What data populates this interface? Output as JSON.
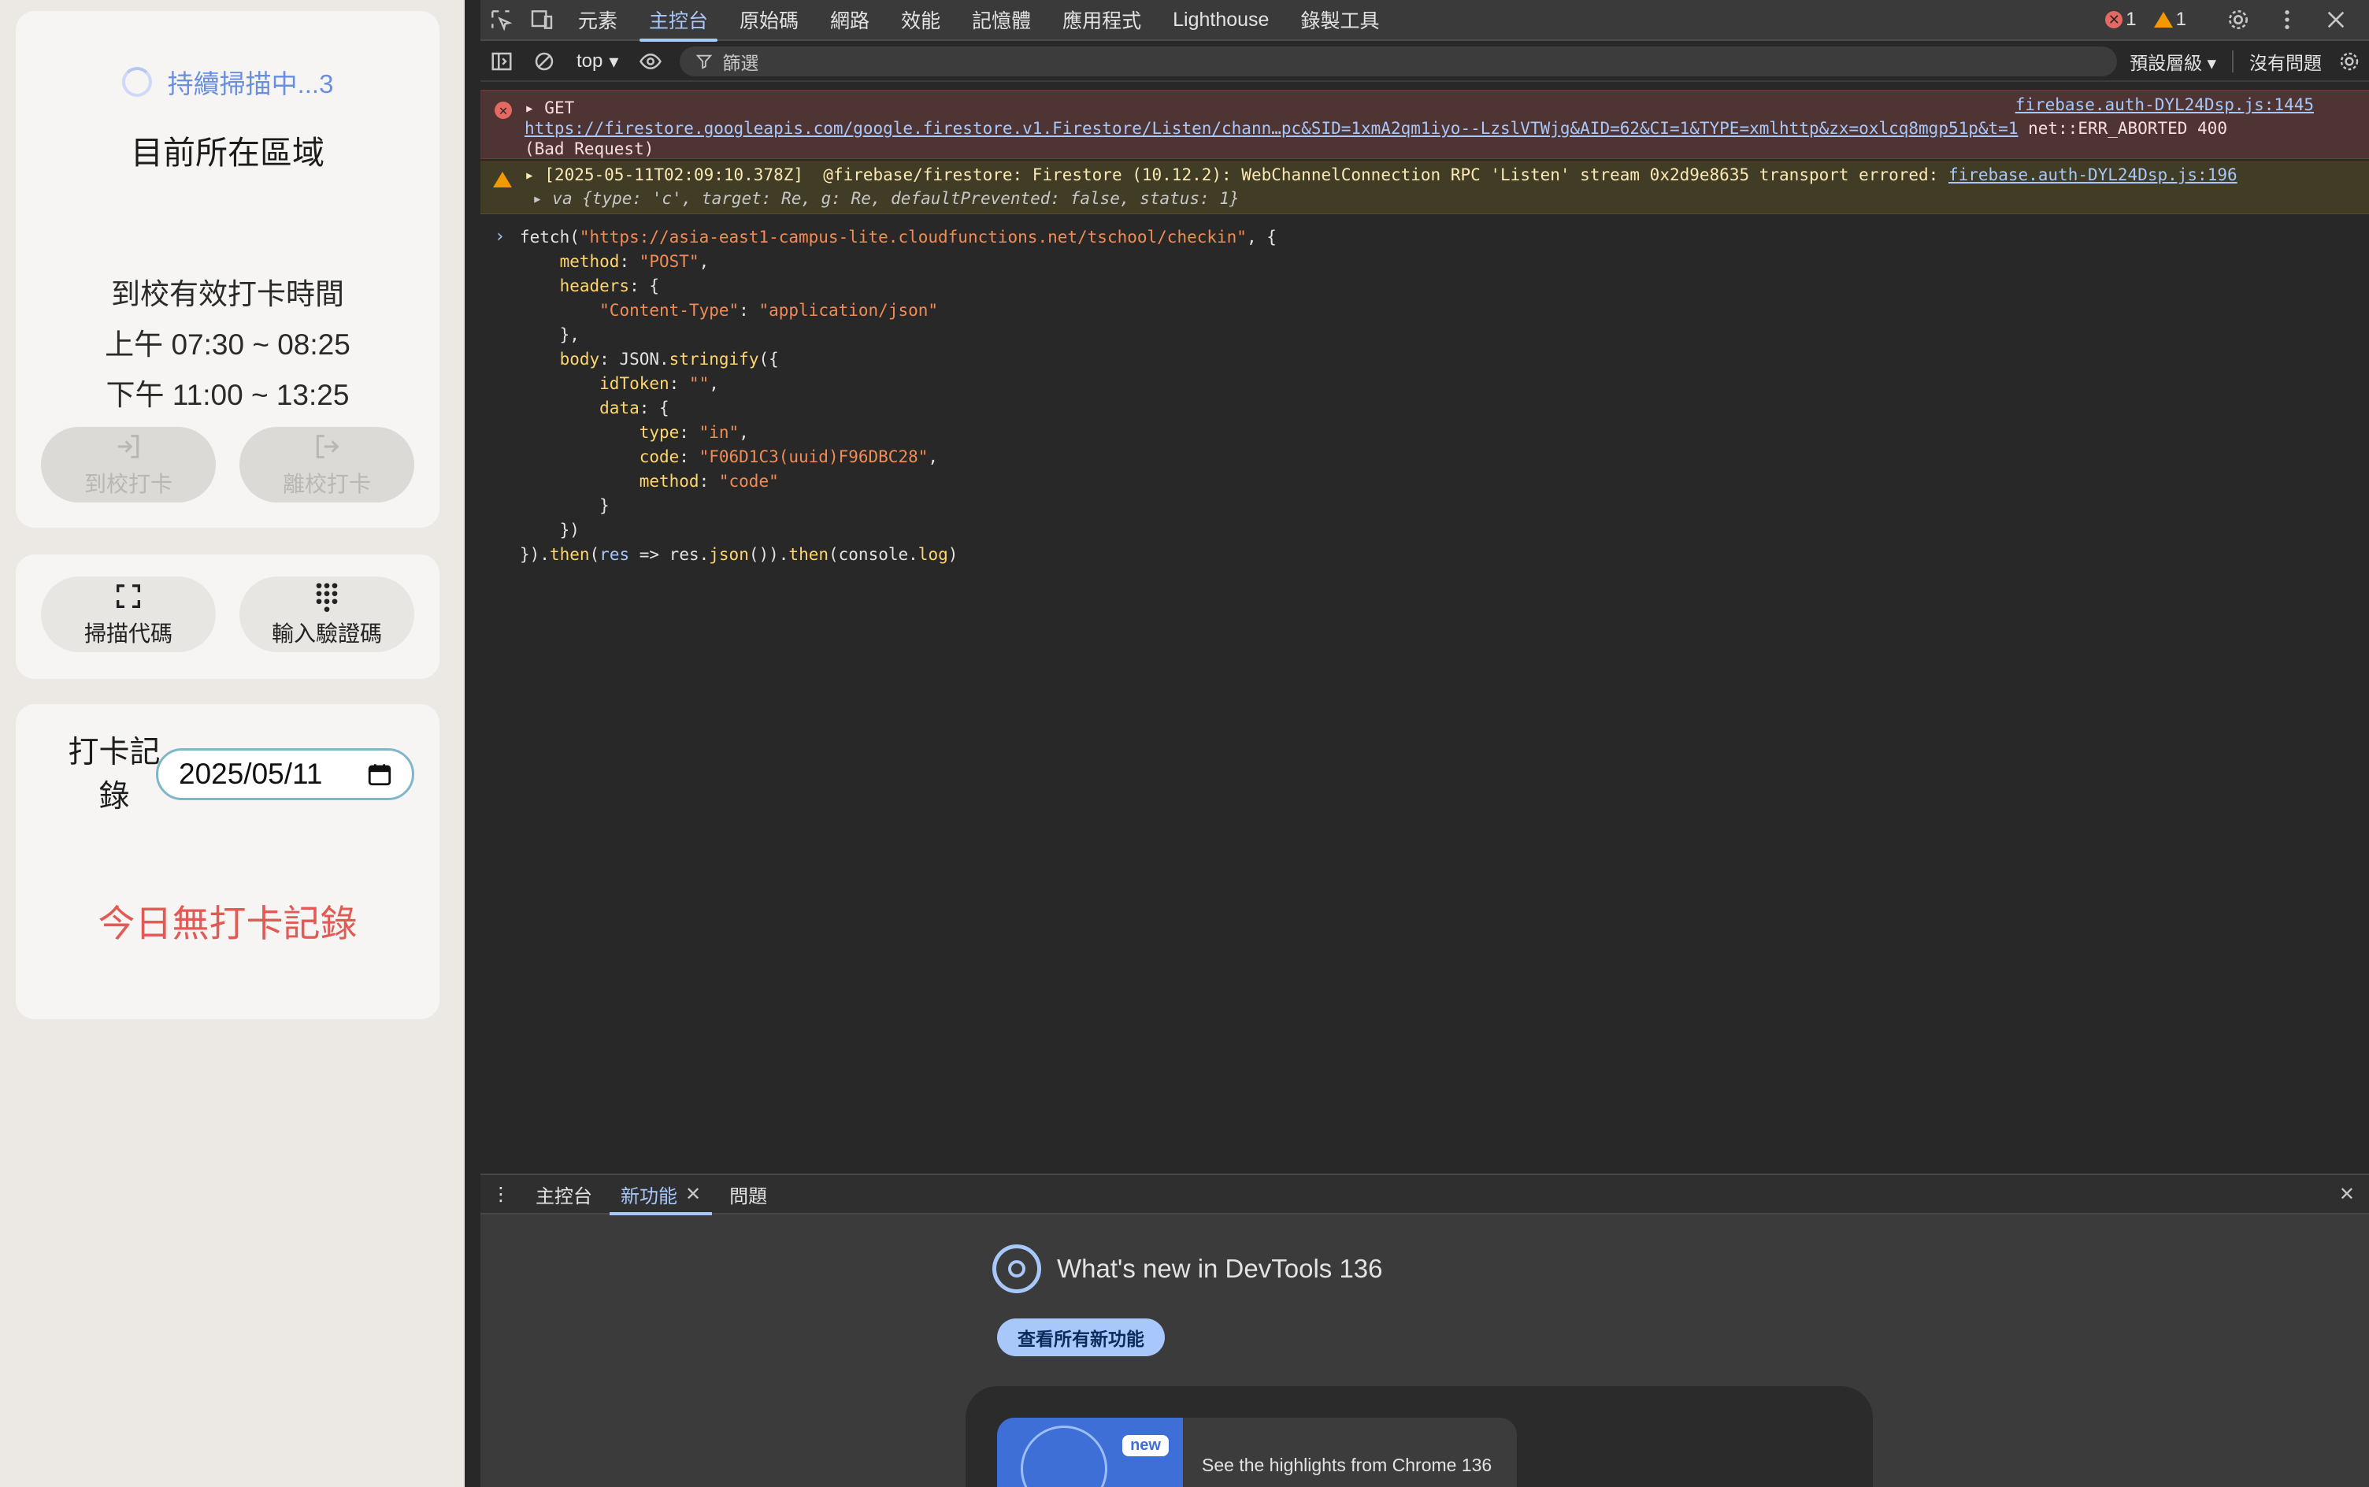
{
  "app": {
    "scan_status": "持續掃描中...3",
    "area_title": "目前所在區域",
    "checkin_time_title": "到校有效打卡時間",
    "morning_range": "上午 07:30 ~ 08:25",
    "afternoon_range": "下午 11:00 ~ 13:25",
    "checkin_label": "到校打卡",
    "checkout_label": "離校打卡",
    "scan_code_label": "掃描代碼",
    "enter_code_label": "輸入驗證碼",
    "records_label": "打卡記錄",
    "date_value": "2025/05/11",
    "no_record_text": "今日無打卡記錄"
  },
  "devtools": {
    "tabs": [
      "元素",
      "主控台",
      "原始碼",
      "網路",
      "效能",
      "記憶體",
      "應用程式",
      "Lighthouse",
      "錄製工具"
    ],
    "active_tab": "主控台",
    "error_count": "1",
    "warning_count": "1",
    "toolbar": {
      "context": "top",
      "filter_placeholder": "篩選",
      "levels": "預設層級",
      "issues": "沒有問題"
    },
    "error_msg": {
      "method": "GET",
      "url": "https://firestore.googleapis.com/google.firestore.v1.Firestore/Listen/chann…pc&SID=1xmA2qm1iyo--LzslVTWjg&AID=62&CI=1&TYPE=xmlhttp&zx=oxlcq8mgp51p&t=1",
      "status": " net::ERR_ABORTED 400",
      "status2": "(Bad Request)",
      "source": "firebase.auth-DYL24Dsp.js:1445"
    },
    "warn_msg": {
      "text": "[2025-05-11T02:09:10.378Z]  @firebase/firestore: Firestore (10.12.2): WebChannelConnection RPC 'Listen' stream 0x2d9e8635 transport errored:",
      "source": "firebase.auth-DYL24Dsp.js:196",
      "detail": "va {type: 'c', target: Re, g: Re, defaultPrevented: false, status: 1}"
    },
    "drawer": {
      "tabs": [
        "主控台",
        "新功能",
        "問題"
      ],
      "active_tab": "新功能",
      "whats_new_title": "What's new in DevTools 136",
      "see_all_button": "查看所有新功能",
      "highlight_badge": "new",
      "highlight_text": "See the highlights from Chrome 136"
    }
  }
}
